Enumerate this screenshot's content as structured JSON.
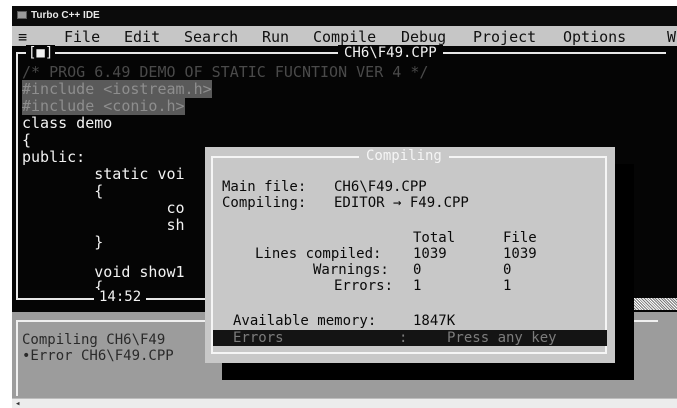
{
  "window": {
    "title": "Turbo C++ IDE"
  },
  "menu": {
    "system_glyph": "≡",
    "items": [
      "File",
      "Edit",
      "Search",
      "Run",
      "Compile",
      "Debug",
      "Project",
      "Options",
      "W"
    ]
  },
  "editor": {
    "close_box": "[■]",
    "file_title": "CH6\\F49.CPP",
    "lines": [
      "/* PROG 6.49 DEMO OF STATIC FUCNTION VER 4 */",
      "#include <iostream.h>",
      "#include <conio.h>",
      "class demo",
      "{",
      "public:",
      "        static voi",
      "        {",
      "                co",
      "                sh",
      "        }",
      "",
      "        void show1",
      "        {"
    ],
    "cursor_position": "14:52"
  },
  "messages": {
    "lines": [
      "Compiling CH6\\F49",
      "•Error CH6\\F49.CPP"
    ]
  },
  "dialog": {
    "title": "Compiling",
    "main_file_label": "Main file:",
    "main_file": "CH6\\F49.CPP",
    "compiling_label": "Compiling:",
    "compiling": "EDITOR → F49.CPP",
    "col_total": "Total",
    "col_file": "File",
    "rows": [
      {
        "label": "Lines compiled:",
        "total": "1039",
        "file": "1039"
      },
      {
        "label": "Warnings:",
        "total": "0",
        "file": "0"
      },
      {
        "label": "Errors:",
        "total": "1",
        "file": "1"
      }
    ],
    "memory_label": "Available memory:",
    "memory": "1847K",
    "status_left": "Errors",
    "status_sep": ":",
    "status_right": "Press any key"
  }
}
